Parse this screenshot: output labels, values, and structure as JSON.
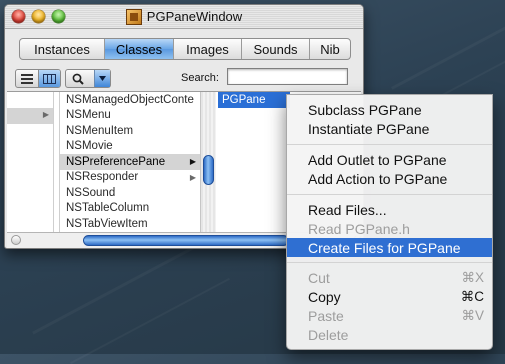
{
  "window": {
    "title": "PGPaneWindow",
    "tabs": [
      {
        "label": "Instances"
      },
      {
        "label": "Classes"
      },
      {
        "label": "Images"
      },
      {
        "label": "Sounds"
      },
      {
        "label": "Nib"
      }
    ],
    "selected_tab": "Classes",
    "view_modes": [
      "list-icon",
      "columns-icon"
    ],
    "search": {
      "label": "Search:",
      "value": ""
    }
  },
  "browser": {
    "column2": [
      {
        "label": "NSManagedObjectConte",
        "has_children": false
      },
      {
        "label": "NSMenu",
        "has_children": false
      },
      {
        "label": "NSMenuItem",
        "has_children": false
      },
      {
        "label": "NSMovie",
        "has_children": false
      },
      {
        "label": "NSPreferencePane",
        "has_children": true,
        "selected": true
      },
      {
        "label": "NSResponder",
        "has_children": true
      },
      {
        "label": "NSSound",
        "has_children": false
      },
      {
        "label": "NSTableColumn",
        "has_children": false
      },
      {
        "label": "NSTabViewItem",
        "has_children": false
      }
    ],
    "column3_selected": "PGPane"
  },
  "context_menu": {
    "items": [
      {
        "label": "Subclass PGPane",
        "enabled": true
      },
      {
        "label": "Instantiate PGPane",
        "enabled": true
      },
      {
        "separator": true
      },
      {
        "label": "Add Outlet to PGPane",
        "enabled": true
      },
      {
        "label": "Add Action to PGPane",
        "enabled": true
      },
      {
        "separator": true
      },
      {
        "label": "Read Files...",
        "enabled": true
      },
      {
        "label": "Read PGPane.h",
        "enabled": false
      },
      {
        "label": "Create Files for PGPane",
        "enabled": true,
        "highlighted": true
      },
      {
        "separator": true
      },
      {
        "label": "Cut",
        "shortcut": "⌘X",
        "enabled": false
      },
      {
        "label": "Copy",
        "shortcut": "⌘C",
        "enabled": true
      },
      {
        "label": "Paste",
        "shortcut": "⌘V",
        "enabled": false
      },
      {
        "label": "Delete",
        "enabled": false
      }
    ]
  },
  "colors": {
    "selection_blue": "#2f6fd2",
    "desktop": "#2c4153"
  }
}
